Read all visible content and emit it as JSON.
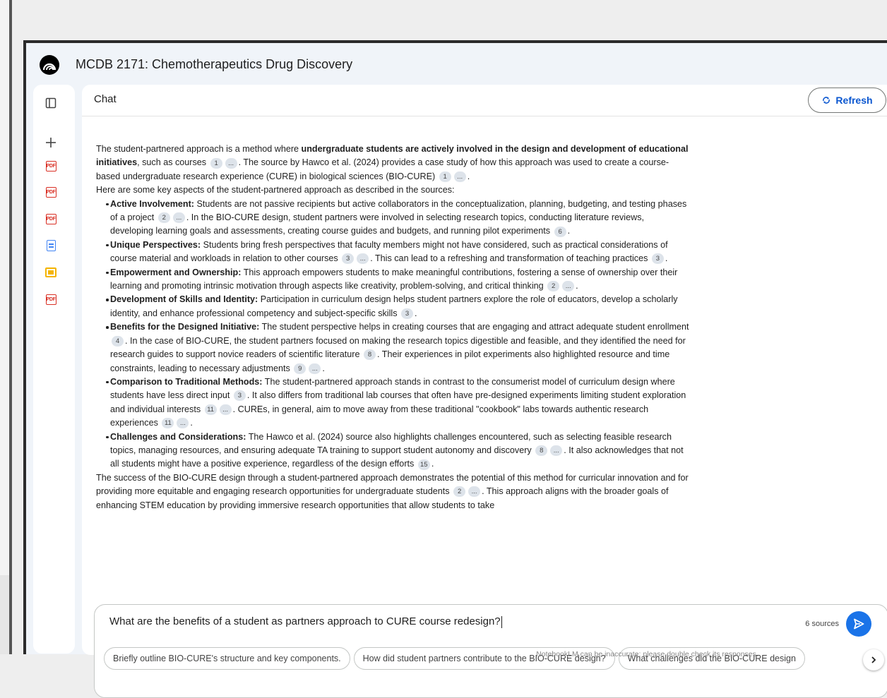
{
  "app": {
    "title": "MCDB 2171: Chemotherapeutics Drug Discovery"
  },
  "sidebar": {
    "items": [
      {
        "icon": "panel-toggle-icon"
      },
      {
        "icon": "add-icon"
      },
      {
        "icon": "pdf-icon",
        "label": "PDF"
      },
      {
        "icon": "pdf-icon",
        "label": "PDF"
      },
      {
        "icon": "pdf-icon",
        "label": "PDF"
      },
      {
        "icon": "doc-icon"
      },
      {
        "icon": "slides-icon"
      },
      {
        "icon": "pdf-icon",
        "label": "PDF"
      }
    ],
    "pdf_label": "PDF"
  },
  "chat": {
    "title": "Chat",
    "refresh_label": "Refresh",
    "ellipsis": "...",
    "intro": {
      "t1": "The student-partnered approach is a method where ",
      "b1": "undergraduate students are actively involved in the design and development of educational initiatives",
      "t2": ", such as courses ",
      "c1": "1",
      "t3": ". The source by Hawco et al. (2024) provides a case study of how this approach was used to create a course-based undergraduate research experience (CURE) in biological sciences (BIO-CURE) ",
      "c2": "1",
      "t4": "."
    },
    "lead": "Here are some key aspects of the student-partnered approach as described in the sources:",
    "bullets": [
      {
        "title": "Active Involvement:",
        "t1": " Students are not passive recipients but active collaborators in the conceptualization, planning, budgeting, and testing phases of a project ",
        "c1": "2",
        "t2": ". In the BIO-CURE design, student partners were involved in selecting research topics, conducting literature reviews, developing learning goals and assessments, creating course guides and budgets, and running pilot experiments ",
        "c2": "6",
        "t3": "."
      },
      {
        "title": "Unique Perspectives:",
        "t1": " Students bring fresh perspectives that faculty members might not have considered, such as practical considerations of course material and workloads in relation to other courses ",
        "c1": "3",
        "t2": ". This can lead to a refreshing and transformation of teaching practices ",
        "c2": "3",
        "t3": "."
      },
      {
        "title": "Empowerment and Ownership:",
        "t1": " This approach empowers students to make meaningful contributions, fostering a sense of ownership over their learning and promoting intrinsic motivation through aspects like creativity, problem-solving, and critical thinking ",
        "c1": "2",
        "t2": "."
      },
      {
        "title": "Development of Skills and Identity:",
        "t1": " Participation in curriculum design helps student partners explore the role of educators, develop a scholarly identity, and enhance professional competency and subject-specific skills ",
        "c1": "3",
        "t2": "."
      },
      {
        "title": "Benefits for the Designed Initiative:",
        "t1": " The student perspective helps in creating courses that are engaging and attract adequate student enrollment ",
        "c1": "4",
        "t2": ". In the case of BIO-CURE, the student partners focused on making the research topics digestible and feasible, and they identified the need for research guides to support novice readers of scientific literature ",
        "c2": "8",
        "t3": ". Their experiences in pilot experiments also highlighted resource and time constraints, leading to necessary adjustments ",
        "c3": "9",
        "t4": "."
      },
      {
        "title": "Comparison to Traditional Methods:",
        "t1": " The student-partnered approach stands in contrast to the consumerist model of curriculum design where students have less direct input ",
        "c1": "3",
        "t2": ". It also differs from traditional lab courses that often have pre-designed experiments limiting student exploration and individual interests ",
        "c2": "11",
        "t3": ". CUREs, in general, aim to move away from these traditional \"cookbook\" labs towards authentic research experiences ",
        "c3": "11",
        "t4": "."
      },
      {
        "title": "Challenges and Considerations:",
        "t1": " The Hawco et al. (2024) source also highlights challenges encountered, such as selecting feasible research topics, managing resources, and ensuring adequate TA training to support student autonomy and discovery ",
        "c1": "8",
        "t2": ". It also acknowledges that not all students might have a positive experience, regardless of the design efforts ",
        "c2": "15",
        "t3": "."
      }
    ],
    "conclusion": {
      "t1": "The success of the BIO-CURE design through a student-partnered approach demonstrates the potential of this method for curricular innovation and for providing more equitable and engaging research opportunities for undergraduate students ",
      "c1": "2",
      "t2": ". This approach aligns with the broader goals of enhancing STEM education by providing immersive research opportunities that allow students to take"
    }
  },
  "composer": {
    "query": "What are the benefits of a student as partners approach to CURE course redesign?",
    "sources_label": "6 sources",
    "suggestions": [
      "Briefly outline BIO-CURE's structure and key components.",
      "How did student partners contribute to the BIO-CURE design?",
      "What challenges did the BIO-CURE design"
    ]
  },
  "footer": {
    "disclaimer": "NotebookLM can be inaccurate; please double check its responses."
  },
  "colors": {
    "accent": "#1a73e8",
    "pdf": "#d93025",
    "doc": "#4285f4",
    "slides": "#f4b400"
  }
}
